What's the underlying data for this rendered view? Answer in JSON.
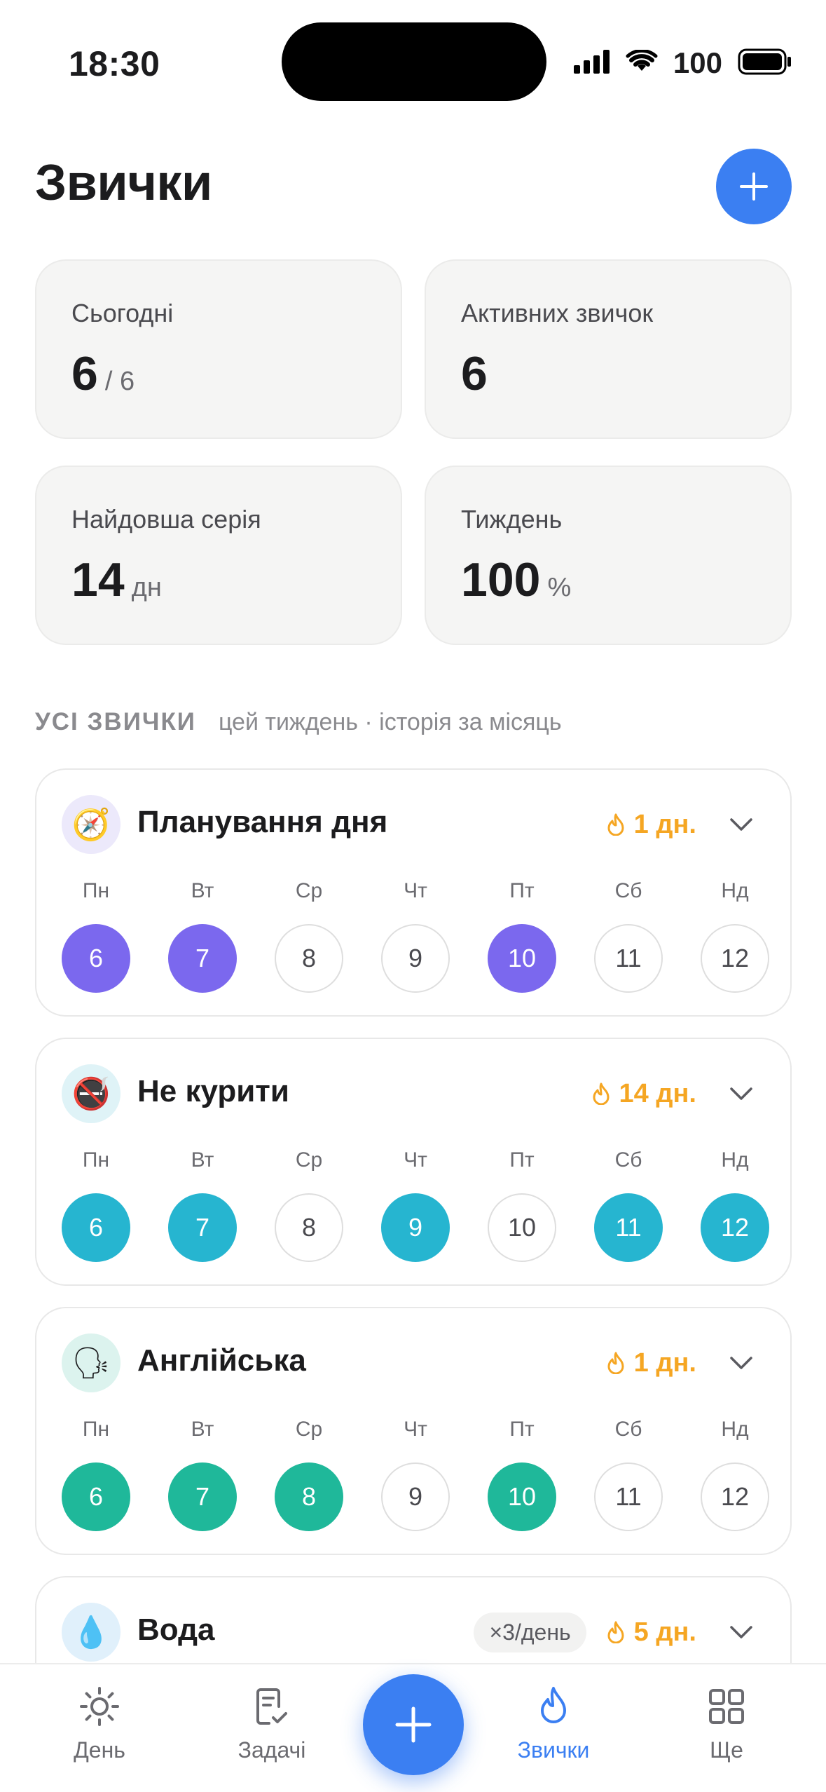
{
  "status_bar": {
    "time": "18:30",
    "battery": "100"
  },
  "header": {
    "title": "Звички"
  },
  "stats": [
    {
      "label": "Сьогодні",
      "value": "6",
      "unit": "/ 6"
    },
    {
      "label": "Активних звичок",
      "value": "6",
      "unit": ""
    },
    {
      "label": "Найдовша серія",
      "value": "14",
      "unit": "дн"
    },
    {
      "label": "Тиждень",
      "value": "100",
      "unit": "%"
    }
  ],
  "section": {
    "title": "УСІ ЗВИЧКИ",
    "subtitle": "цей тиждень · історія за місяць"
  },
  "weekdays": [
    "Пн",
    "Вт",
    "Ср",
    "Чт",
    "Пт",
    "Сб",
    "Нд"
  ],
  "habits": [
    {
      "name": "Планування дня",
      "icon": "🧭",
      "icon_name": "compass-icon",
      "icon_bg": "#ece9fb",
      "color": "#7b68ee",
      "streak": "1 дн.",
      "freq": "",
      "days": [
        "6",
        "7",
        "8",
        "9",
        "10",
        "11",
        "12"
      ],
      "done": [
        true,
        true,
        false,
        false,
        true,
        false,
        false
      ]
    },
    {
      "name": "Не курити",
      "icon": "🚭",
      "icon_name": "no-smoking-icon",
      "icon_bg": "#dff3f7",
      "color": "#26b5d0",
      "streak": "14 дн.",
      "freq": "",
      "days": [
        "6",
        "7",
        "8",
        "9",
        "10",
        "11",
        "12"
      ],
      "done": [
        true,
        true,
        false,
        true,
        false,
        true,
        true
      ]
    },
    {
      "name": "Англійська",
      "icon": "🗣",
      "icon_name": "speaking-head-icon",
      "icon_bg": "#dcf3ee",
      "color": "#1fb89a",
      "streak": "1 дн.",
      "freq": "",
      "days": [
        "6",
        "7",
        "8",
        "9",
        "10",
        "11",
        "12"
      ],
      "done": [
        true,
        true,
        true,
        false,
        true,
        false,
        false
      ]
    },
    {
      "name": "Вода",
      "icon": "💧",
      "icon_name": "water-drop-icon",
      "icon_bg": "#e0f0fb",
      "color": "#3b9cf2",
      "streak": "5 дн.",
      "freq": "×3/день",
      "days": [],
      "done": []
    }
  ],
  "tabs": [
    {
      "label": "День",
      "icon": "sun-icon",
      "active": false
    },
    {
      "label": "Задачі",
      "icon": "tasks-icon",
      "active": false
    },
    {
      "label": "Звички",
      "icon": "flame-icon",
      "active": true
    },
    {
      "label": "Ще",
      "icon": "grid-icon",
      "active": false
    }
  ],
  "colors": {
    "accent": "#3b7ff2",
    "streak": "#f5a623"
  }
}
